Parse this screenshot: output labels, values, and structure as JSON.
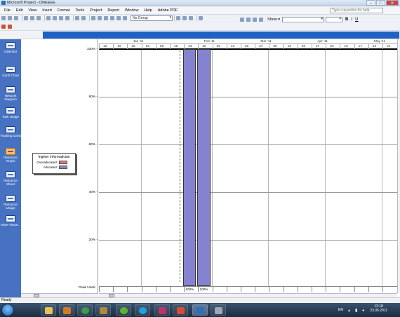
{
  "window": {
    "title": "Microsoft Project - ONEEEE",
    "min": "–",
    "max": "□",
    "close": "✕"
  },
  "menu": {
    "items": [
      "File",
      "Edit",
      "View",
      "Insert",
      "Format",
      "Tools",
      "Project",
      "Report",
      "Window",
      "Help",
      "Adobe PDF"
    ],
    "help_placeholder": "Type a question for help"
  },
  "toolbar": {
    "group_value": "No Group",
    "show_label": "Show ▾",
    "font_bold": "B",
    "font_italic": "I",
    "font_underline": "U"
  },
  "viewbar": {
    "items": [
      {
        "label": "Calendar",
        "icon": "calendar-icon"
      },
      {
        "label": "Gantt Chart",
        "icon": "gantt-icon"
      },
      {
        "label": "Network Diagram",
        "icon": "network-icon"
      },
      {
        "label": "Task Usage",
        "icon": "task-usage-icon"
      },
      {
        "label": "Tracking Gantt",
        "icon": "tracking-gantt-icon"
      },
      {
        "label": "Resource Graph",
        "icon": "resource-graph-icon"
      },
      {
        "label": "Resource Sheet",
        "icon": "resource-sheet-icon"
      },
      {
        "label": "Resource Usage",
        "icon": "resource-usage-icon"
      },
      {
        "label": "More Views...",
        "icon": "more-views-icon"
      }
    ]
  },
  "legend": {
    "title": "Inginer informatician",
    "overallocated": "Overallocated:",
    "allocated": "Allocated:",
    "overallocated_color": "#e07878",
    "allocated_color": "#8582cf"
  },
  "timeline": {
    "months": [
      "Jan '11",
      "Feb '11",
      "Mar '11",
      "Apr '11",
      "May '11"
    ],
    "days": [
      "12",
      "19",
      "26",
      "02",
      "09",
      "16",
      "23",
      "30",
      "06",
      "13",
      "20",
      "27",
      "06",
      "13",
      "20",
      "27",
      "03",
      "10",
      "17",
      "24",
      "01"
    ]
  },
  "chart_data": {
    "type": "bar",
    "title": "",
    "ylabel": "",
    "y_ticks": [
      "100%",
      "80%",
      "60%",
      "40%",
      "20%"
    ],
    "ylim": [
      0,
      100
    ],
    "categories": [
      "23",
      "30"
    ],
    "series": [
      {
        "name": "Allocated",
        "values": [
          100,
          100
        ]
      }
    ],
    "peak_label": "Peak Units:",
    "peak_values": [
      "100%",
      "100%"
    ]
  },
  "status": {
    "text": "Ready"
  },
  "taskbar": {
    "lang": "EN",
    "time": "12:18",
    "date": "23.05.2011"
  }
}
